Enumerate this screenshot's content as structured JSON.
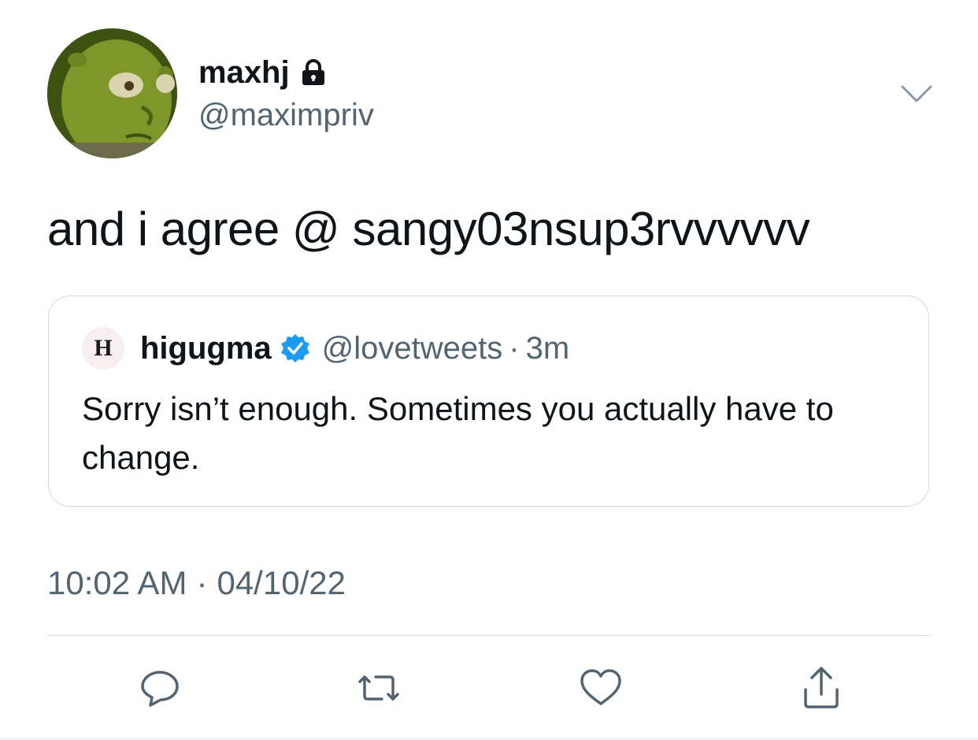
{
  "author": {
    "display_name": "maxhj",
    "handle": "@maximpriv",
    "protected": true,
    "avatar_icon": "shrek-avatar"
  },
  "tweet": {
    "text": "and i agree @ sangy03nsup3rvvvvvv",
    "timestamp_time": "10:02 AM",
    "timestamp_separator": "·",
    "timestamp_date": "04/10/22"
  },
  "quoted_tweet": {
    "avatar_letter": "H",
    "display_name": "higugma",
    "verified": true,
    "handle": "@lovetweets",
    "separator": "·",
    "time_ago": "3m",
    "text": "Sorry isn’t enough. Sometimes you actually have to change."
  },
  "actions": {
    "reply_icon": "reply-icon",
    "retweet_icon": "retweet-icon",
    "like_icon": "heart-icon",
    "share_icon": "share-icon"
  },
  "colors": {
    "primary_text": "#0f1419",
    "secondary_text": "#536471",
    "border": "#cfd9de",
    "verified_blue": "#1d9bf0"
  }
}
